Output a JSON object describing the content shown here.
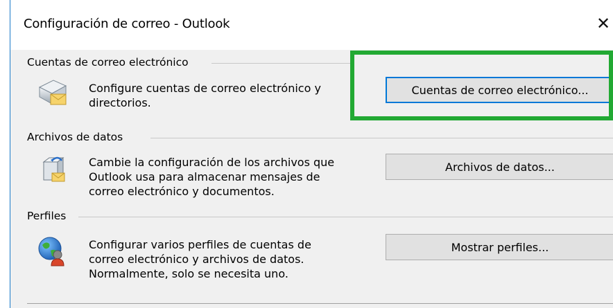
{
  "window": {
    "title": "Configuración de correo - Outlook",
    "close_glyph": "✕"
  },
  "sections": [
    {
      "header": "Cuentas de correo electrónico",
      "description_lines": [
        "Configure cuentas de correo electrónico y",
        "directorios."
      ],
      "button_label": "Cuentas de correo electrónico...",
      "icon": "email-accounts-icon"
    },
    {
      "header": "Archivos de datos",
      "description_lines": [
        "Cambie la configuración de los archivos que",
        "Outlook usa para almacenar mensajes de",
        "correo electrónico y documentos."
      ],
      "button_label": "Archivos de datos...",
      "icon": "data-files-icon"
    },
    {
      "header": "Perfiles",
      "description_lines": [
        "Configurar varios perfiles de cuentas de",
        "correo electrónico y archivos de datos.",
        "Normalmente, solo se necesita uno."
      ],
      "button_label": "Mostrar perfiles...",
      "icon": "profiles-icon"
    }
  ],
  "highlight_color": "#22a933",
  "accent_color": "#0078d7"
}
